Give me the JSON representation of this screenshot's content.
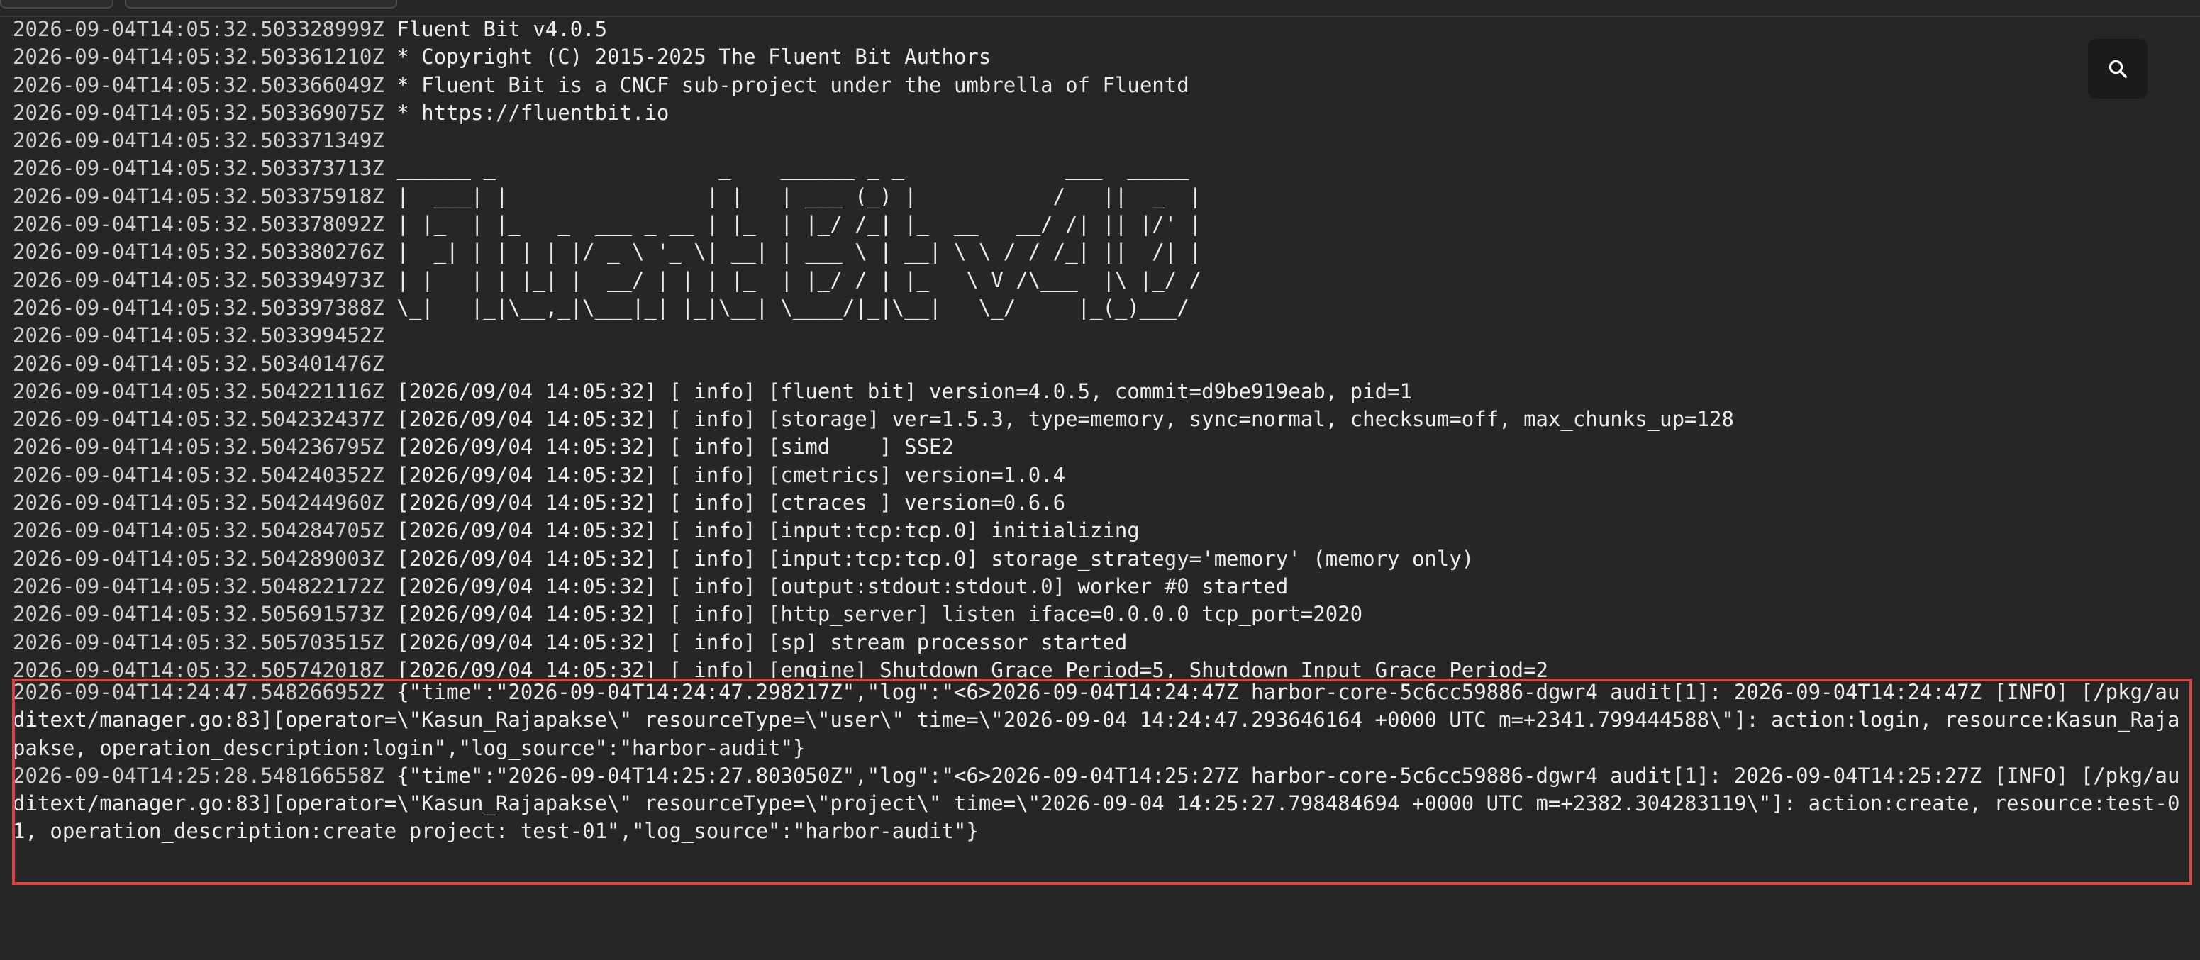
{
  "log": {
    "lines": [
      {
        "ts": "2026-09-04T14:05:32.503328999Z",
        "msg": "Fluent Bit v4.0.5"
      },
      {
        "ts": "2026-09-04T14:05:32.503361210Z",
        "msg": "* Copyright (C) 2015-2025 The Fluent Bit Authors"
      },
      {
        "ts": "2026-09-04T14:05:32.503366049Z",
        "msg": "* Fluent Bit is a CNCF sub-project under the umbrella of Fluentd"
      },
      {
        "ts": "2026-09-04T14:05:32.503369075Z",
        "msg": "* https://fluentbit.io"
      },
      {
        "ts": "2026-09-04T14:05:32.503371349Z",
        "msg": ""
      },
      {
        "ts": "2026-09-04T14:05:32.503373713Z",
        "msg": "______ _                  _    ______ _ _             ___  _____"
      },
      {
        "ts": "2026-09-04T14:05:32.503375918Z",
        "msg": "|  ___| |                | |   | ___ (_) |           /   ||  _  |"
      },
      {
        "ts": "2026-09-04T14:05:32.503378092Z",
        "msg": "| |_  | |_   _  ___ _ __ | |_  | |_/ /_| |_  __   __/ /| || |/' |"
      },
      {
        "ts": "2026-09-04T14:05:32.503380276Z",
        "msg": "|  _| | | | | |/ _ \\ '_ \\| __| | ___ \\ | __| \\ \\ / / /_| ||  /| |"
      },
      {
        "ts": "2026-09-04T14:05:32.503394973Z",
        "msg": "| |   | | |_| |  __/ | | | |_  | |_/ / | |_   \\ V /\\___  |\\ |_/ /"
      },
      {
        "ts": "2026-09-04T14:05:32.503397388Z",
        "msg": "\\_|   |_|\\__,_|\\___|_| |_|\\__| \\____/|_|\\__|   \\_/     |_(_)___/"
      },
      {
        "ts": "2026-09-04T14:05:32.503399452Z",
        "msg": ""
      },
      {
        "ts": "2026-09-04T14:05:32.503401476Z",
        "msg": ""
      },
      {
        "ts": "2026-09-04T14:05:32.504221116Z",
        "msg": "[2026/09/04 14:05:32] [ info] [fluent bit] version=4.0.5, commit=d9be919eab, pid=1"
      },
      {
        "ts": "2026-09-04T14:05:32.504232437Z",
        "msg": "[2026/09/04 14:05:32] [ info] [storage] ver=1.5.3, type=memory, sync=normal, checksum=off, max_chunks_up=128"
      },
      {
        "ts": "2026-09-04T14:05:32.504236795Z",
        "msg": "[2026/09/04 14:05:32] [ info] [simd    ] SSE2"
      },
      {
        "ts": "2026-09-04T14:05:32.504240352Z",
        "msg": "[2026/09/04 14:05:32] [ info] [cmetrics] version=1.0.4"
      },
      {
        "ts": "2026-09-04T14:05:32.504244960Z",
        "msg": "[2026/09/04 14:05:32] [ info] [ctraces ] version=0.6.6"
      },
      {
        "ts": "2026-09-04T14:05:32.504284705Z",
        "msg": "[2026/09/04 14:05:32] [ info] [input:tcp:tcp.0] initializing"
      },
      {
        "ts": "2026-09-04T14:05:32.504289003Z",
        "msg": "[2026/09/04 14:05:32] [ info] [input:tcp:tcp.0] storage_strategy='memory' (memory only)"
      },
      {
        "ts": "2026-09-04T14:05:32.504822172Z",
        "msg": "[2026/09/04 14:05:32] [ info] [output:stdout:stdout.0] worker #0 started"
      },
      {
        "ts": "2026-09-04T14:05:32.505691573Z",
        "msg": "[2026/09/04 14:05:32] [ info] [http_server] listen iface=0.0.0.0 tcp_port=2020"
      },
      {
        "ts": "2026-09-04T14:05:32.505703515Z",
        "msg": "[2026/09/04 14:05:32] [ info] [sp] stream processor started"
      },
      {
        "ts": "2026-09-04T14:05:32.505742018Z",
        "msg": "[2026/09/04 14:05:32] [ info] [engine] Shutdown Grace Period=5, Shutdown Input Grace Period=2"
      }
    ],
    "highlighted": [
      {
        "ts": "2026-09-04T14:24:47.548266952Z",
        "msg": "{\"time\":\"2026-09-04T14:24:47.298217Z\",\"log\":\"<6>2026-09-04T14:24:47Z harbor-core-5c6cc59886-dgwr4 audit[1]: 2026-09-04T14:24:47Z [INFO] [/pkg/auditext/manager.go:83][operator=\\\"Kasun_Rajapakse\\\" resourceType=\\\"user\\\" time=\\\"2026-09-04 14:24:47.293646164 +0000 UTC m=+2341.799444588\\\"]: action:login, resource:Kasun_Rajapakse, operation_description:login\",\"log_source\":\"harbor-audit\"}"
      },
      {
        "ts": "2026-09-04T14:25:28.548166558Z",
        "msg": "{\"time\":\"2026-09-04T14:25:27.803050Z\",\"log\":\"<6>2026-09-04T14:25:27Z harbor-core-5c6cc59886-dgwr4 audit[1]: 2026-09-04T14:25:27Z [INFO] [/pkg/auditext/manager.go:83][operator=\\\"Kasun_Rajapakse\\\" resourceType=\\\"project\\\" time=\\\"2026-09-04 14:25:27.798484694 +0000 UTC m=+2382.304283119\\\"]: action:create, resource:test-01, operation_description:create project: test-01\",\"log_source\":\"harbor-audit\"}"
      }
    ]
  },
  "toolbar": {
    "search_icon": "search-icon"
  },
  "colors": {
    "background": "#262626",
    "text": "#e6e6e6",
    "highlight_border": "#d64545",
    "search_button_bg": "#1b1b1b"
  }
}
